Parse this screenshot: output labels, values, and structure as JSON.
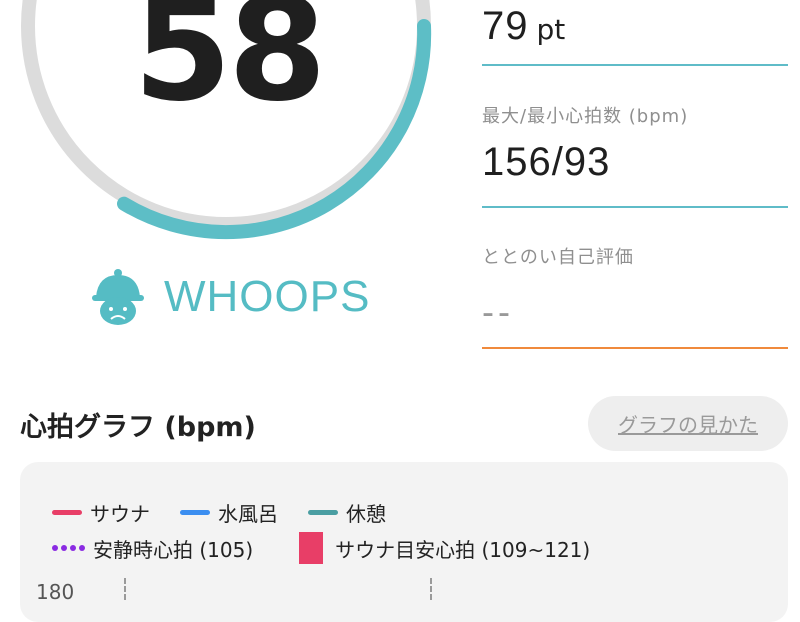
{
  "gauge": {
    "score": "58",
    "progress_fraction": 0.62,
    "track_color": "#dcdcdc",
    "progress_color": "#5dbec6"
  },
  "status": {
    "icon": "sad-sauna-hat-icon",
    "label": "WHOOPS",
    "color": "#55bcc4"
  },
  "stats": {
    "points": {
      "value": "79",
      "unit": "pt"
    },
    "heart_rate": {
      "label": "最大/最小心拍数 (bpm)",
      "value": "156/93"
    },
    "self_rating": {
      "label": "ととのい自己評価",
      "value": "--"
    }
  },
  "graph": {
    "title": "心拍グラフ (bpm)",
    "howto_label": "グラフの見かた",
    "legend": [
      {
        "label": "サウナ",
        "color": "#e83e67"
      },
      {
        "label": "水風呂",
        "color": "#3b8ef0"
      },
      {
        "label": "休憩",
        "color": "#4a9ea2"
      }
    ],
    "legend_lines": {
      "resting": "安静時心拍 (105)",
      "target": "サウナ目安心拍 (109~121)"
    },
    "y_tick_top": "180"
  }
}
